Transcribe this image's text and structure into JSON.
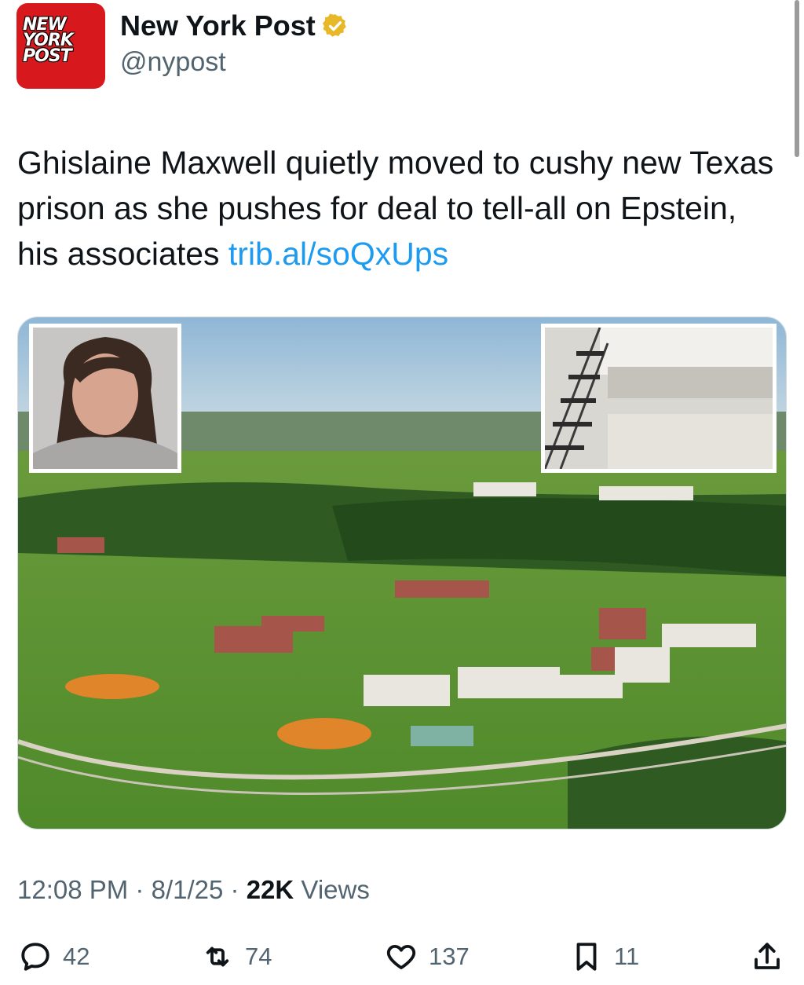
{
  "account": {
    "avatar_text_lines": [
      "NEW",
      "YORK",
      "POST"
    ],
    "display_name": "New York Post",
    "handle": "@nypost",
    "verified_icon": "verified-badge-icon",
    "brand_color": "#d7191e",
    "verified_color": "#e8b829"
  },
  "tweet": {
    "text": "Ghislaine Maxwell quietly moved to cushy new Texas prison as she pushes for deal to tell-all on Epstein, his associates ",
    "link": "trib.al/soQxUps",
    "link_color": "#1d9bf0"
  },
  "meta": {
    "time": "12:08 PM",
    "separator": "·",
    "date": "8/1/25",
    "views_count": "22K",
    "views_label": "Views"
  },
  "actions": {
    "reply": {
      "icon": "reply-icon",
      "count": "42"
    },
    "retweet": {
      "icon": "retweet-icon",
      "count": "74"
    },
    "like": {
      "icon": "heart-icon",
      "count": "137"
    },
    "bookmark": {
      "icon": "bookmark-icon",
      "count": "11"
    },
    "share": {
      "icon": "share-icon"
    }
  }
}
